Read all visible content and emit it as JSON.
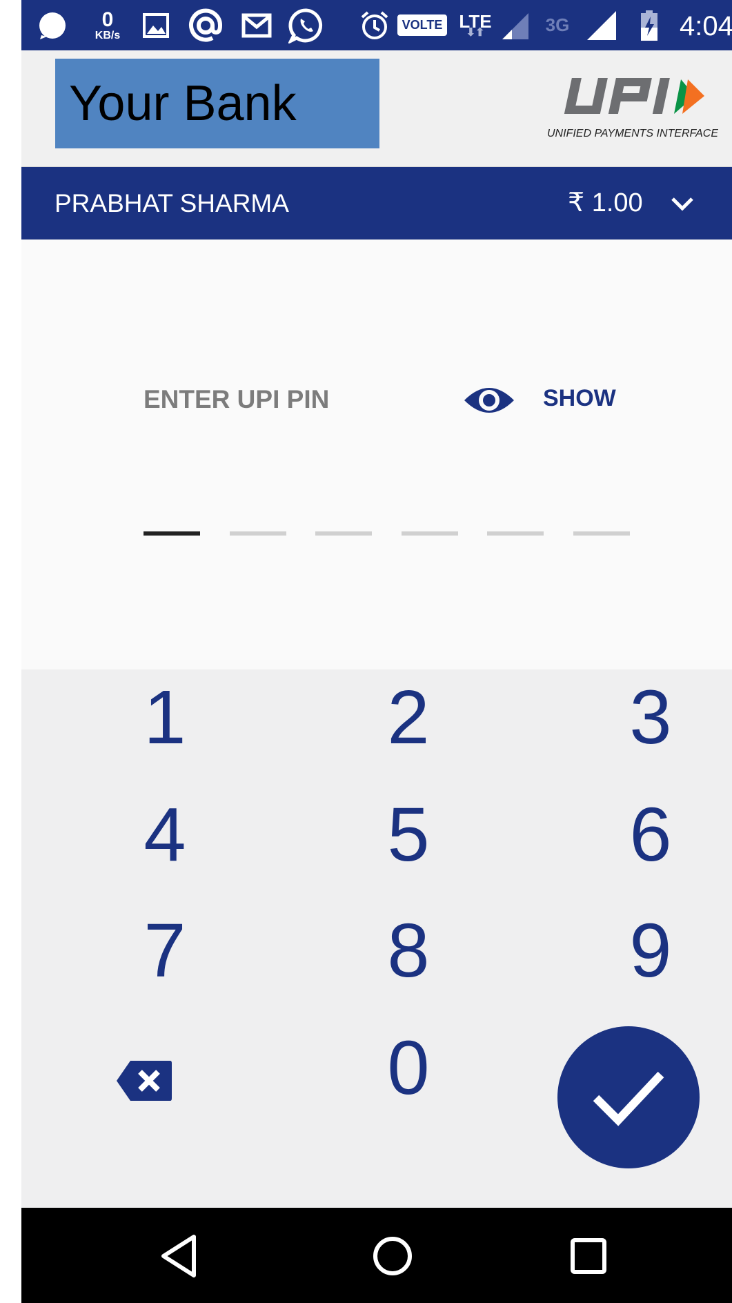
{
  "status_bar": {
    "kb_value": "0",
    "kb_unit": "KB/s",
    "volte": "VOLTE",
    "lte": "LTE",
    "network_3g": "3G",
    "time": "4:04"
  },
  "header": {
    "bank_name": "Your Bank",
    "upi_tagline": "UNIFIED PAYMENTS INTERFACE"
  },
  "payee": {
    "name": "PRABHAT SHARMA",
    "amount": "₹ 1.00"
  },
  "pin": {
    "label": "ENTER UPI PIN",
    "show_label": "SHOW",
    "digits_total": 6,
    "digits_entered": 0
  },
  "keypad": {
    "keys": [
      "1",
      "2",
      "3",
      "4",
      "5",
      "6",
      "7",
      "8",
      "9",
      "0"
    ]
  },
  "colors": {
    "primary": "#1b3281",
    "bank_box": "#5084c1",
    "upi_orange": "#f37021",
    "upi_green": "#0a9346",
    "upi_gray": "#6d6e71"
  }
}
